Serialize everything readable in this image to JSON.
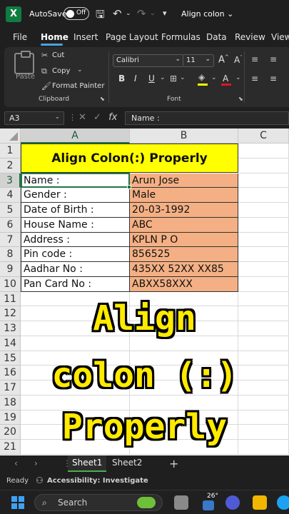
{
  "titlebar": {
    "autosave_label": "AutoSave",
    "autosave_state": "Off",
    "doc_title": "Align colon",
    "title_caret": "⌄"
  },
  "ribbon_tabs": [
    "File",
    "Home",
    "Insert",
    "Page Layout",
    "Formulas",
    "Data",
    "Review",
    "View"
  ],
  "ribbon": {
    "paste_label": "Paste",
    "cut_label": "Cut",
    "copy_label": "Copy",
    "format_painter_label": "Format Painter",
    "clipboard_group": "Clipboard",
    "font_name": "Calibri",
    "font_size": "11",
    "font_group": "Font",
    "bold": "B",
    "italic": "I",
    "underline": "U"
  },
  "formula_bar": {
    "name_box": "A3",
    "fx": "fx",
    "content": "Name   :"
  },
  "grid": {
    "columns": [
      "A",
      "B",
      "C"
    ],
    "rows": [
      "1",
      "2",
      "3",
      "4",
      "5",
      "6",
      "7",
      "8",
      "9",
      "10",
      "11",
      "12",
      "13",
      "14",
      "15",
      "16",
      "17",
      "18",
      "19",
      "20",
      "21"
    ],
    "title": "Align Colon(:) Properly",
    "records": [
      {
        "label": "Name   :",
        "value": "Arun Jose"
      },
      {
        "label": "Gender  :",
        "value": "Male"
      },
      {
        "label": "Date of Birth :",
        "value": "20-03-1992"
      },
      {
        "label": "House Name  :",
        "value": "ABC"
      },
      {
        "label": "Address :",
        "value": "KPLN P O"
      },
      {
        "label": "Pin code   :",
        "value": "856525"
      },
      {
        "label": "Aadhar No   :",
        "value": "435XX 52XX XX85"
      },
      {
        "label": "Pan Card No  :",
        "value": "ABXX58XXX"
      }
    ]
  },
  "overlay": {
    "line1": "Align",
    "line2": "colon (:)",
    "line3": "Properly"
  },
  "sheets": {
    "tabs": [
      "Sheet1",
      "Sheet2"
    ],
    "active": "Sheet1",
    "add": "+"
  },
  "status": {
    "ready": "Ready",
    "accessibility": "Accessibility: Investigate"
  },
  "taskbar": {
    "search_placeholder": "Search",
    "weather_temp": "26°"
  },
  "colors": {
    "title_fill": "#ffff00",
    "value_fill": "#f4b084",
    "overlay_text": "#ffea00",
    "accent": "#217346"
  }
}
